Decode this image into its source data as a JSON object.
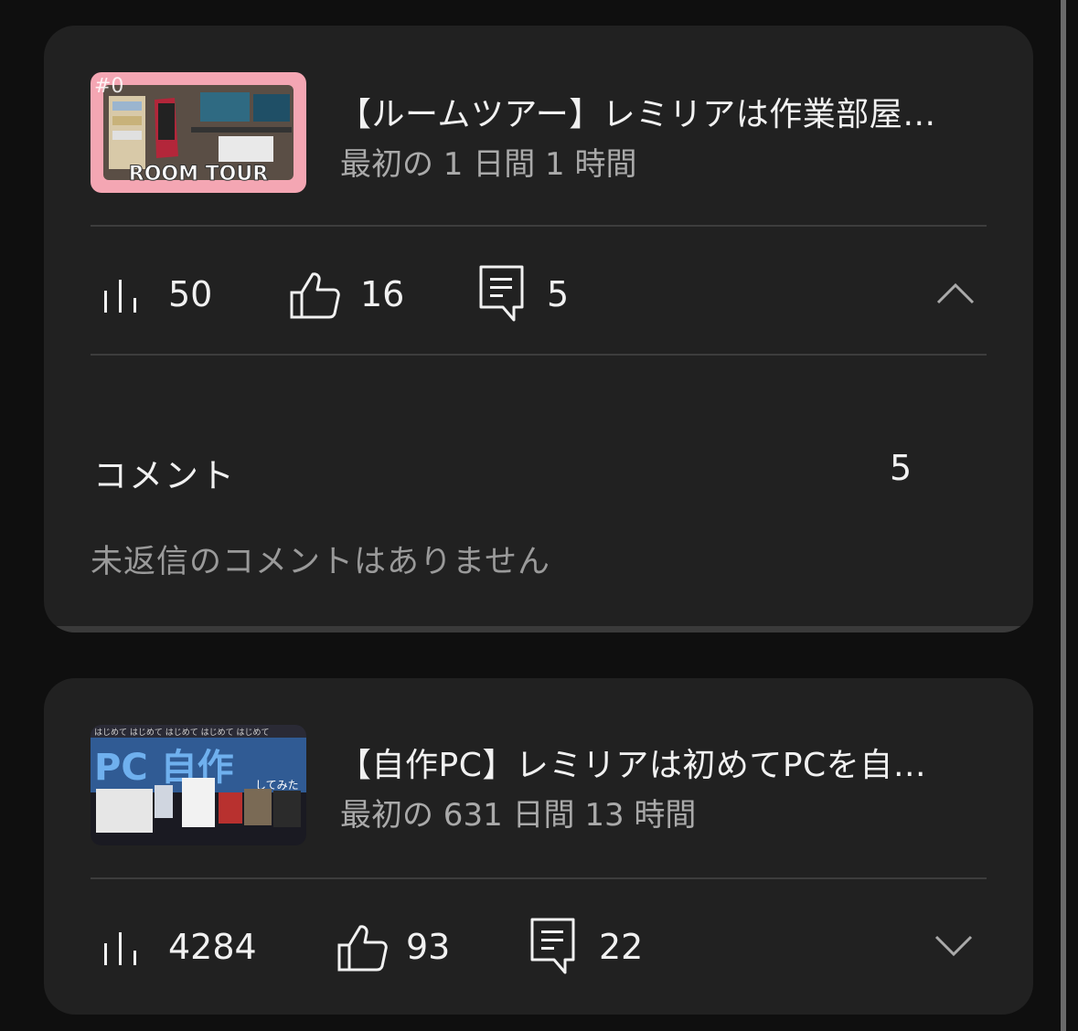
{
  "videos": [
    {
      "title": "【ルームツアー】レミリアは作業部屋…",
      "period": "最初の 1 日間 1 時間",
      "thumbnail_text": "ROOM TOUR",
      "thumbnail_tag": "#0",
      "views": "50",
      "likes": "16",
      "comments": "5",
      "expanded": true,
      "chevron_icon": "chevron-up-icon"
    },
    {
      "title": "【自作PC】レミリアは初めてPCを自…",
      "period": "最初の 631 日間 13 時間",
      "thumbnail_text": "PC 自作",
      "thumbnail_sub": "してみた",
      "views": "4284",
      "likes": "93",
      "comments": "22",
      "expanded": false,
      "chevron_icon": "chevron-down-icon"
    }
  ],
  "comments_section": {
    "title": "コメント",
    "count": "5",
    "empty_message": "未返信のコメントはありません"
  },
  "colors": {
    "background": "#0f0f0f",
    "card": "#212121",
    "text_primary": "#f1f1f1",
    "text_secondary": "#aaaaaa"
  }
}
